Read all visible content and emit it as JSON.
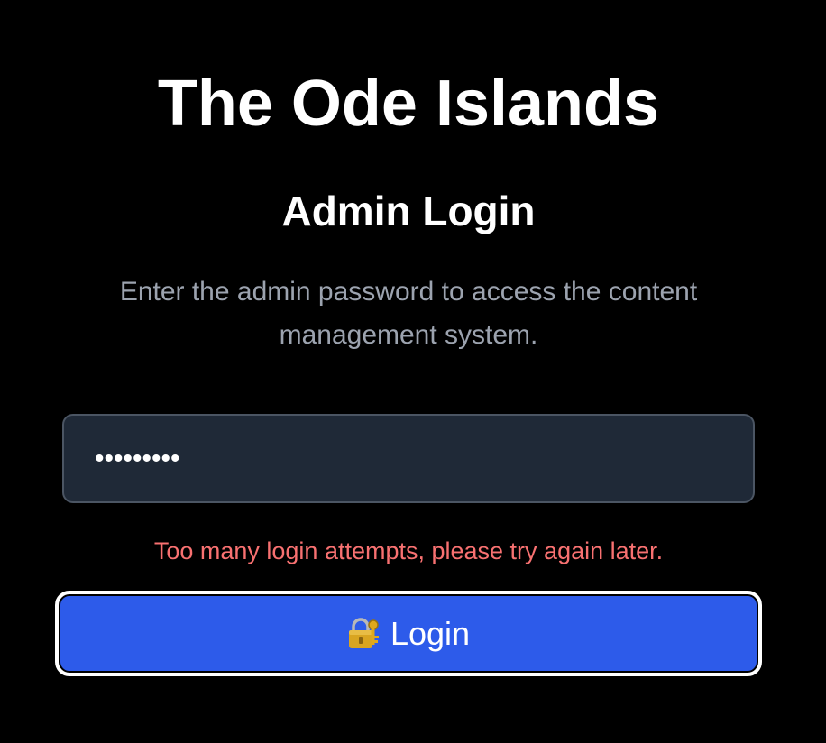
{
  "header": {
    "site_title": "The Ode Islands",
    "section_title": "Admin Login",
    "description": "Enter the admin password to access the content management system."
  },
  "form": {
    "password_value": "123456789",
    "error_message": "Too many login attempts, please try again later.",
    "login_icon": "lock-with-key-icon",
    "login_label": "Login"
  },
  "colors": {
    "background": "#000000",
    "input_background": "#1f2937",
    "error": "#f87171",
    "button": "#2d5bea",
    "muted_text": "#9ca3af"
  }
}
